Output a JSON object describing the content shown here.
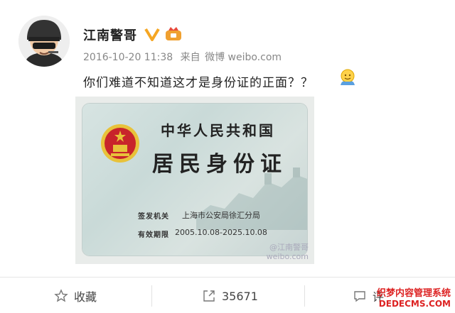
{
  "post": {
    "username": "江南警哥",
    "timestamp": "2016-10-20 11:38",
    "source_prefix": "来自",
    "source": "微博 weibo.com",
    "text": "你们难道不知道这才是身份证的正面？？"
  },
  "icons": {
    "verify": "verified-v-badge",
    "member": "member-crown-icon",
    "emoji": "face-emoji",
    "favorite": "star-icon",
    "repost": "share-out-icon",
    "comment": "comment-bubble-icon"
  },
  "id_card": {
    "title_line1": "中华人民共和国",
    "title_line2": "居民身份证",
    "authority_label": "签发机关",
    "authority_value": "上海市公安局徐汇分局",
    "validity_label": "有效期限",
    "validity_value": "2005.10.08-2025.10.08"
  },
  "image_watermark": {
    "line1": "@江南警哥",
    "line2": "weibo.com"
  },
  "actions": {
    "favorite_label": "收藏",
    "repost_count": "35671",
    "comment_label": "评"
  },
  "site_watermark": {
    "line1": "织梦内容管理系统",
    "line2": "DEDECMS.COM"
  },
  "colors": {
    "verify_badge": "#f5a623",
    "emblem_red": "#c8242b",
    "emblem_gold": "#e8c23a",
    "watermark_red": "#dd2222"
  }
}
